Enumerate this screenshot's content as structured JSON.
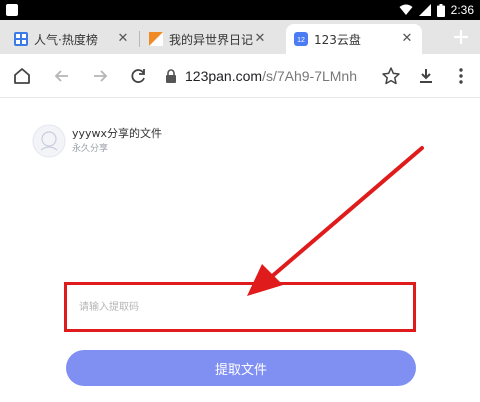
{
  "statusbar": {
    "time": "2:36",
    "icons": [
      "app-notification-icon",
      "wifi-icon",
      "signal-icon",
      "battery-icon"
    ]
  },
  "tabs": [
    {
      "title": "人气·热度榜",
      "favicon": "grid-favicon-icon",
      "active": false
    },
    {
      "title": "我的异世界日记",
      "favicon": "orange-flag-favicon-icon",
      "active": false
    },
    {
      "title": "123云盘",
      "favicon": "cloud-favicon-icon",
      "active": true
    }
  ],
  "toolbar": {
    "url_host": "123pan.com",
    "url_path": "/s/7Ah9-7LMnh",
    "icons": [
      "home-icon",
      "back-icon",
      "forward-icon",
      "reload-icon",
      "lock-icon",
      "star-icon",
      "download-icon",
      "more-icon"
    ]
  },
  "share": {
    "title": "yyywx分享的文件",
    "subtitle": "永久分享"
  },
  "password_field": {
    "placeholder": "请输入提取码",
    "value": ""
  },
  "extract_button": {
    "label": "提取文件"
  },
  "colors": {
    "annotation_red": "#e01b1b",
    "button_blue": "#7f8ff2",
    "tab_strip": "#e5e5e5"
  }
}
